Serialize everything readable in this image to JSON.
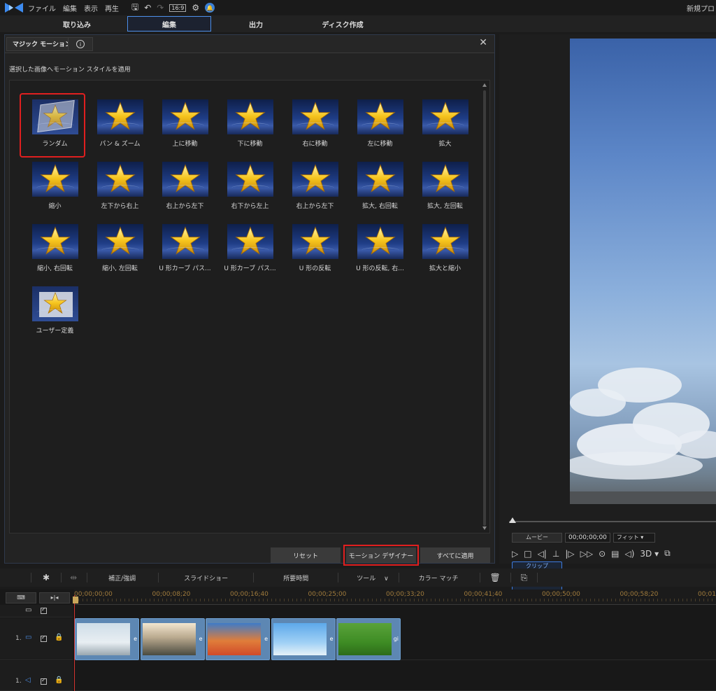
{
  "menubar": {
    "items": [
      "ファイル",
      "編集",
      "表示",
      "再生"
    ],
    "ratio": "16:9",
    "project_name": "新規プロ"
  },
  "tabs": [
    "取り込み",
    "編集",
    "出力",
    "ディスク作成"
  ],
  "active_tab": "編集",
  "panel": {
    "title": "マジック モーション",
    "description": "選択した画像へモーション スタイルを適用",
    "styles": [
      {
        "label": "ランダム",
        "kind": "random",
        "selected": true
      },
      {
        "label": "パン & ズーム"
      },
      {
        "label": "上に移動"
      },
      {
        "label": "下に移動"
      },
      {
        "label": "右に移動"
      },
      {
        "label": "左に移動"
      },
      {
        "label": "拡大"
      },
      {
        "label": "縮小"
      },
      {
        "label": "左下から右上"
      },
      {
        "label": "右上から左下"
      },
      {
        "label": "右下から左上"
      },
      {
        "label": "右上から左下"
      },
      {
        "label": "拡大, 右回転"
      },
      {
        "label": "拡大, 左回転"
      },
      {
        "label": "縮小, 右回転"
      },
      {
        "label": "縮小, 左回転"
      },
      {
        "label": "U 形カーブ パス..."
      },
      {
        "label": "U 形カーブ パス..."
      },
      {
        "label": "U 形の反転"
      },
      {
        "label": "U 形の反転, 右..."
      },
      {
        "label": "拡大と縮小"
      },
      {
        "label": "ユーザー定義",
        "kind": "user"
      }
    ],
    "buttons": {
      "reset": "リセット",
      "motion_designer": "モーション デザイナー",
      "apply_all": "すべてに適用"
    }
  },
  "preview": {
    "mode_clip": "クリップ",
    "mode_movie": "ムービー",
    "timecode": "00;00;00;00",
    "fit": "フィット",
    "threed": "3D"
  },
  "toolbar": {
    "correct": "補正/強調",
    "slideshow": "スライドショー",
    "duration": "所要時間",
    "tools": "ツール",
    "color_match": "カラー マッチ"
  },
  "timeline": {
    "ticks": [
      "00;00;00;00",
      "00;00;08;20",
      "00;00;16;40",
      "00;00;25;00",
      "00;00;33;20",
      "00;00;41;40",
      "00;00;50;00",
      "00;00;58;20",
      "00;01"
    ],
    "video_track_label": "1.",
    "audio_track_label": "1.",
    "clip_ext": [
      "e",
      "e",
      "e",
      "e",
      "gi"
    ]
  },
  "colors": {
    "accent": "#4c8ee8",
    "highlight_red": "#e01f1f",
    "playhead": "#d3332f"
  }
}
